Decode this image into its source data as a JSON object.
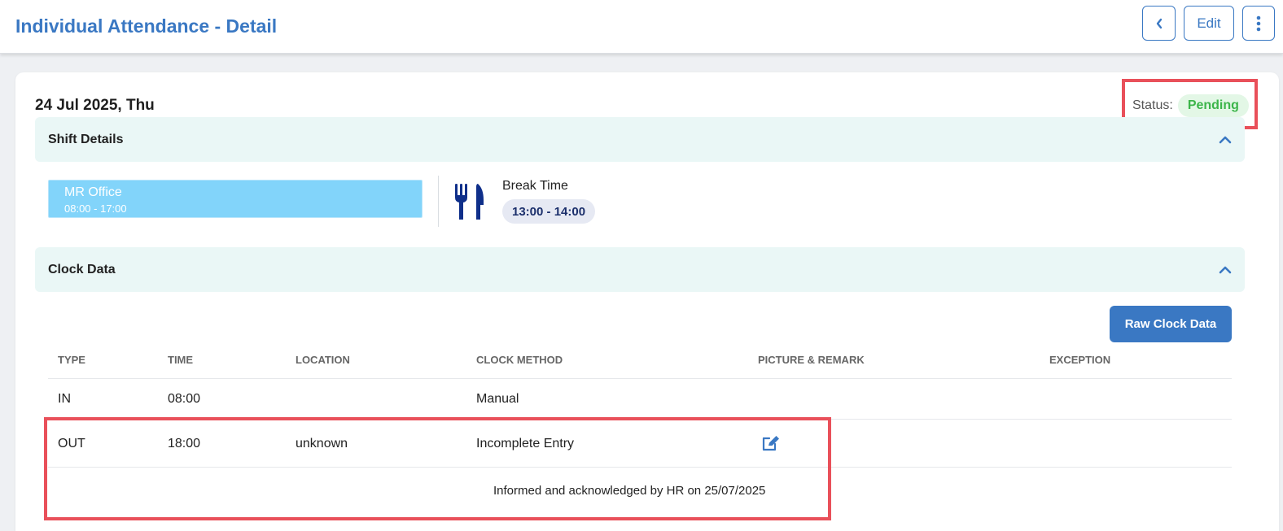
{
  "header": {
    "title": "Individual Attendance - Detail",
    "back_icon": "chevron-left-icon",
    "edit_label": "Edit",
    "more_icon": "more-vertical-icon"
  },
  "record": {
    "date": "24 Jul 2025, Thu",
    "status_label": "Status:",
    "status_value": "Pending",
    "status_color": "#3cb54a"
  },
  "shift_details": {
    "title": "Shift Details",
    "shift_name": "MR Office",
    "shift_time": "08:00 - 17:00",
    "shift_color": "#82d4fa",
    "break_icon": "cutlery-icon",
    "break_title": "Break Time",
    "break_time": "13:00 - 14:00"
  },
  "clock_data": {
    "title": "Clock Data",
    "raw_button": "Raw Clock Data",
    "columns": [
      "TYPE",
      "TIME",
      "LOCATION",
      "CLOCK METHOD",
      "PICTURE & REMARK",
      "EXCEPTION"
    ],
    "rows": [
      {
        "type": "IN",
        "time": "08:00",
        "location": "",
        "method": "Manual"
      },
      {
        "type": "OUT",
        "time": "18:00",
        "location": "unknown",
        "method": "Incomplete Entry",
        "remark_icon": "edit-icon",
        "remark": "Informed and acknowledged by HR on 25/07/2025"
      }
    ]
  },
  "colors": {
    "accent": "#3a78c3",
    "highlight_border": "#e9505a",
    "section_bg": "#eaf7f6"
  }
}
